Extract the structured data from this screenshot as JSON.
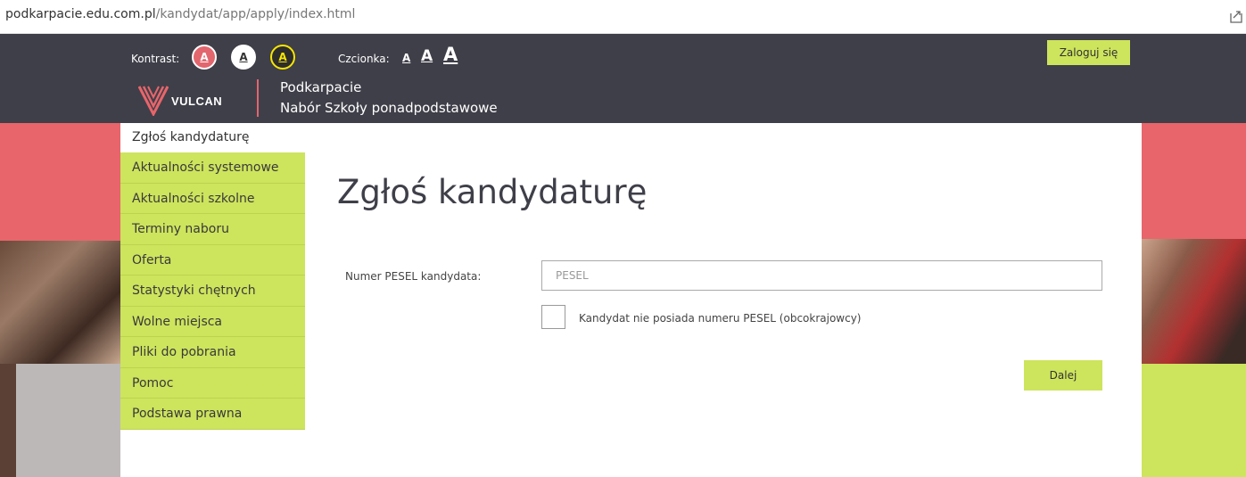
{
  "browser": {
    "url_domain": "podkarpacie.edu.com.pl",
    "url_path": "/kandydat/app/apply/index.html"
  },
  "header": {
    "contrast_label": "Kontrast:",
    "contrast_options": [
      "A",
      "A",
      "A"
    ],
    "font_label": "Czcionka:",
    "font_options": [
      "A",
      "A",
      "A"
    ],
    "login_label": "Zaloguj się",
    "logo_text": "VULCAN",
    "brand_line1": "Podkarpacie",
    "brand_line2": "Nabór Szkoły ponadpodstawowe"
  },
  "nav": {
    "current": "Zgłoś kandydaturę",
    "items": [
      "Aktualności systemowe",
      "Aktualności szkolne",
      "Terminy naboru",
      "Oferta",
      "Statystyki chętnych",
      "Wolne miejsca",
      "Pliki do pobrania",
      "Pomoc",
      "Podstawa prawna"
    ]
  },
  "main": {
    "title": "Zgłoś kandydaturę",
    "pesel_label": "Numer PESEL kandydata:",
    "pesel_placeholder": "PESEL",
    "pesel_value": "",
    "no_pesel_label": "Kandydat nie posiada numeru PESEL (obcokrajowcy)",
    "no_pesel_checked": false,
    "next_label": "Dalej"
  },
  "colors": {
    "header_bg": "#3f3f49",
    "accent_green": "#cde45d",
    "accent_red": "#e8656b"
  }
}
